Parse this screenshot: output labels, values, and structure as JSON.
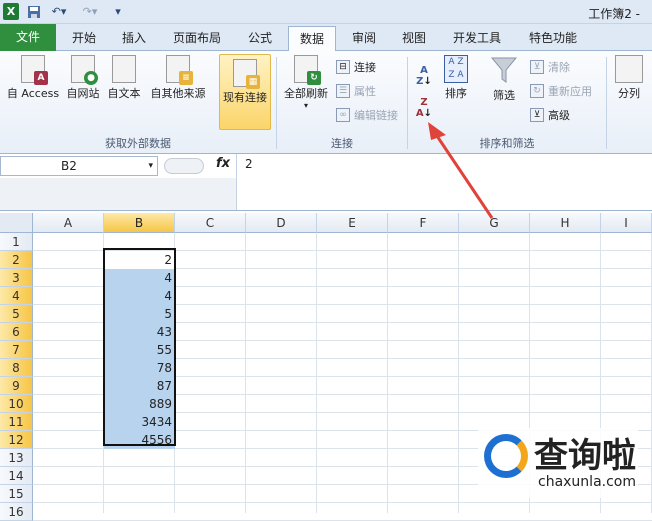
{
  "window": {
    "title": "工作簿2 -",
    "app_icon": "X"
  },
  "quick_access": {
    "save": "save-icon",
    "undo": "undo-icon",
    "redo": "redo-icon",
    "customize": "customize-icon"
  },
  "tabs": [
    "文件",
    "开始",
    "插入",
    "页面布局",
    "公式",
    "数据",
    "审阅",
    "视图",
    "开发工具",
    "特色功能"
  ],
  "active_tab": "数据",
  "ribbon": {
    "external": {
      "access": "自 Access",
      "web": "自网站",
      "text": "自文本",
      "other": "自其他来源",
      "existing": "现有连接",
      "label": "获取外部数据"
    },
    "connections": {
      "refresh_all": "全部刷新",
      "connections": "连接",
      "properties": "属性",
      "edit_links": "编辑链接",
      "label": "连接"
    },
    "sort_filter": {
      "sort": "排序",
      "filter": "筛选",
      "clear": "清除",
      "reapply": "重新应用",
      "advanced": "高级",
      "label": "排序和筛选"
    },
    "tools": {
      "split": "分列"
    }
  },
  "formula_bar": {
    "name_box": "B2",
    "fx": "fx",
    "value": "2"
  },
  "columns": [
    "A",
    "B",
    "C",
    "D",
    "E",
    "F",
    "G",
    "H",
    "I"
  ],
  "selected_column": "B",
  "rows": [
    "1",
    "2",
    "3",
    "4",
    "5",
    "6",
    "7",
    "8",
    "9",
    "10",
    "11",
    "12",
    "13",
    "14",
    "15",
    "16"
  ],
  "cells_B": [
    "2",
    "4",
    "4",
    "5",
    "43",
    "55",
    "78",
    "87",
    "889",
    "3434",
    "4556"
  ],
  "watermark": {
    "main": "查询啦",
    "sub": "chaxunla.com"
  },
  "colors": {
    "selection": "#b8d3ee",
    "header_selected": "#f6c545",
    "file_tab": "#2f8f3f",
    "arrow": "#e0433a"
  }
}
